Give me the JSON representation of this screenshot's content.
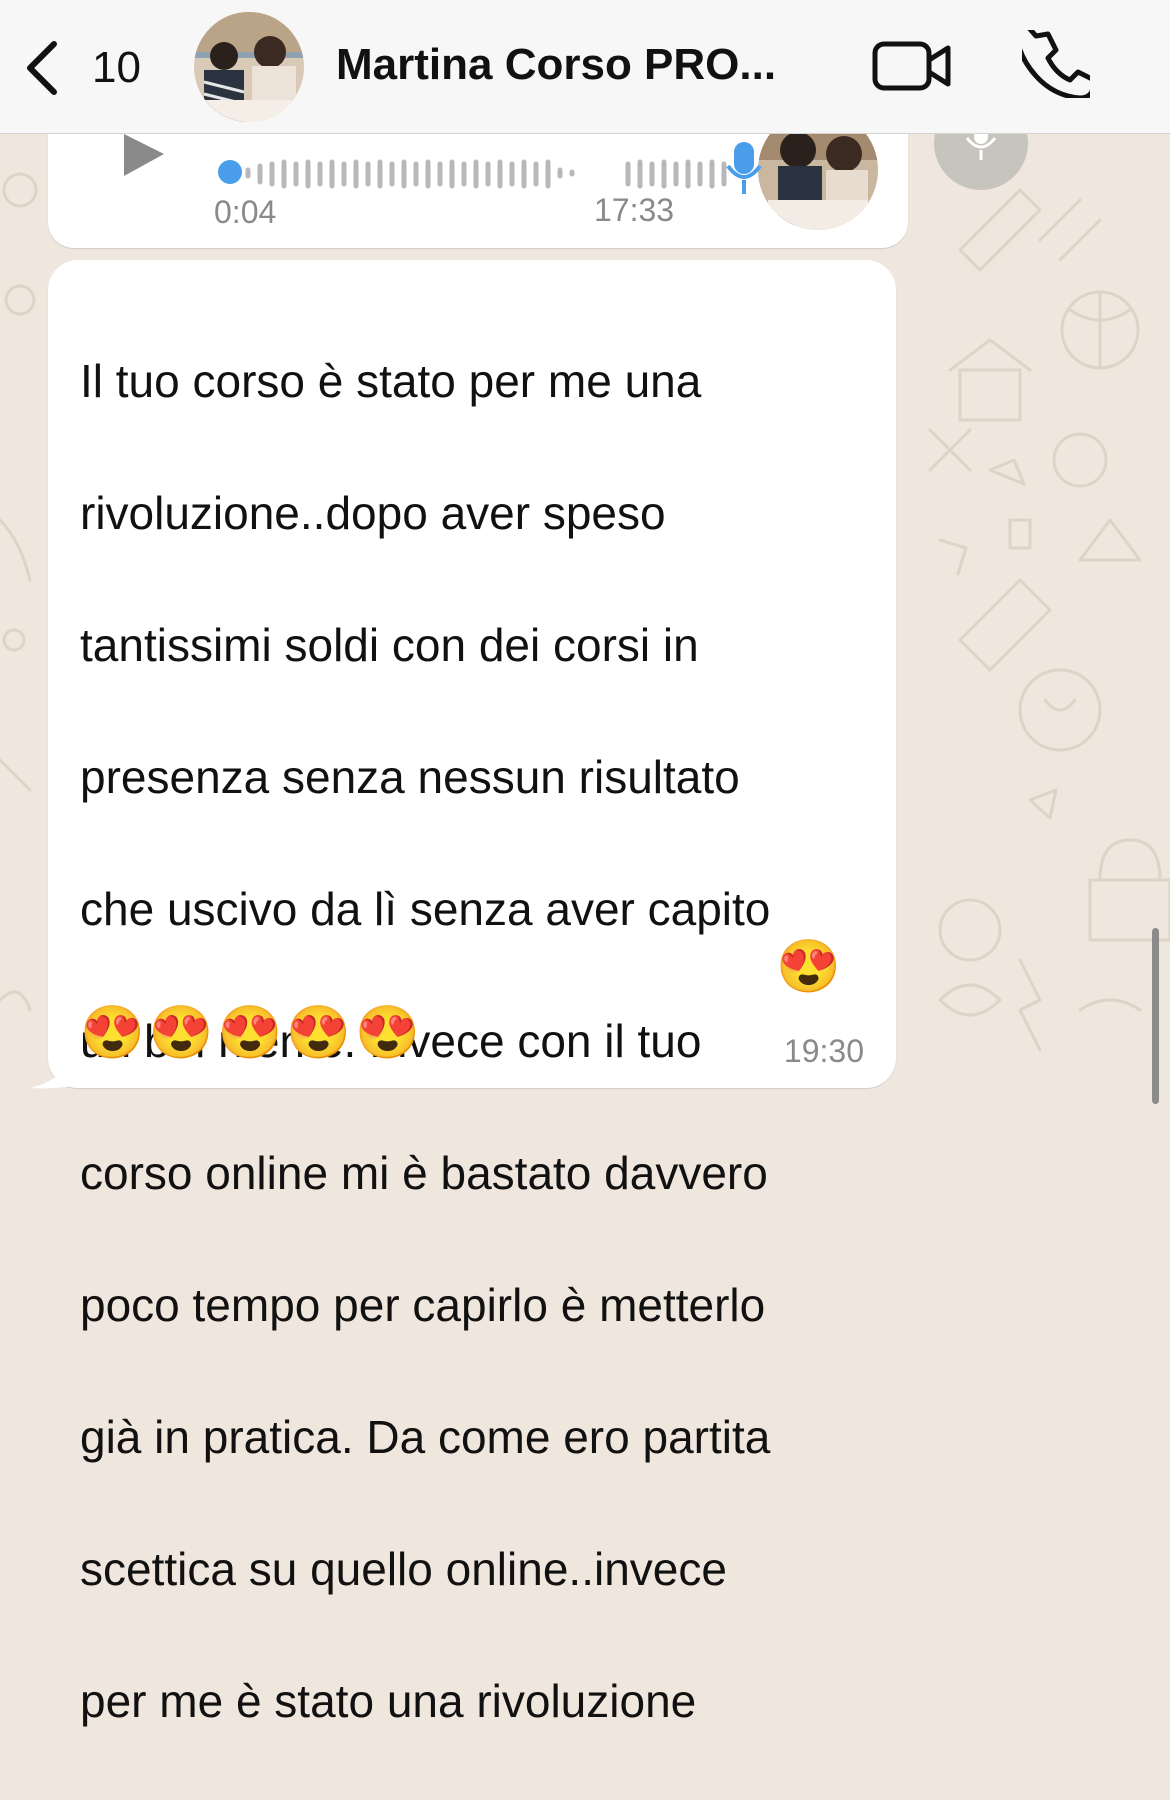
{
  "header": {
    "back_count": "10",
    "title": "Martina Corso PRO..."
  },
  "voice_message": {
    "duration": "0:04",
    "time": "17:33"
  },
  "message": {
    "lines": [
      "Il tuo corso è stato per me una",
      "rivoluzione..dopo aver speso",
      "tantissimi soldi con dei corsi in",
      "presenza senza nessun risultato",
      "che uscivo da lì senza aver capito",
      "un bel niente. Invece con il tuo",
      "corso online mi è bastato davvero",
      "poco tempo per capirlo è metterlo",
      "già in pratica. Da come ero partita",
      "scettica su quello online..invece",
      "per me è stato una rivoluzione"
    ],
    "inline_emoji": "😍",
    "emoji_row": "😍😍😍😍😍",
    "time": "19:30"
  },
  "icons": {
    "back": "chevron-left-icon",
    "video": "video-camera-icon",
    "call": "phone-icon",
    "mic": "microphone-icon",
    "play": "play-icon"
  },
  "colors": {
    "wallpaper": "#efe7dd",
    "bubble": "#ffffff",
    "mic_blue": "#4a9de8",
    "timestamp": "#8a8a8a"
  }
}
